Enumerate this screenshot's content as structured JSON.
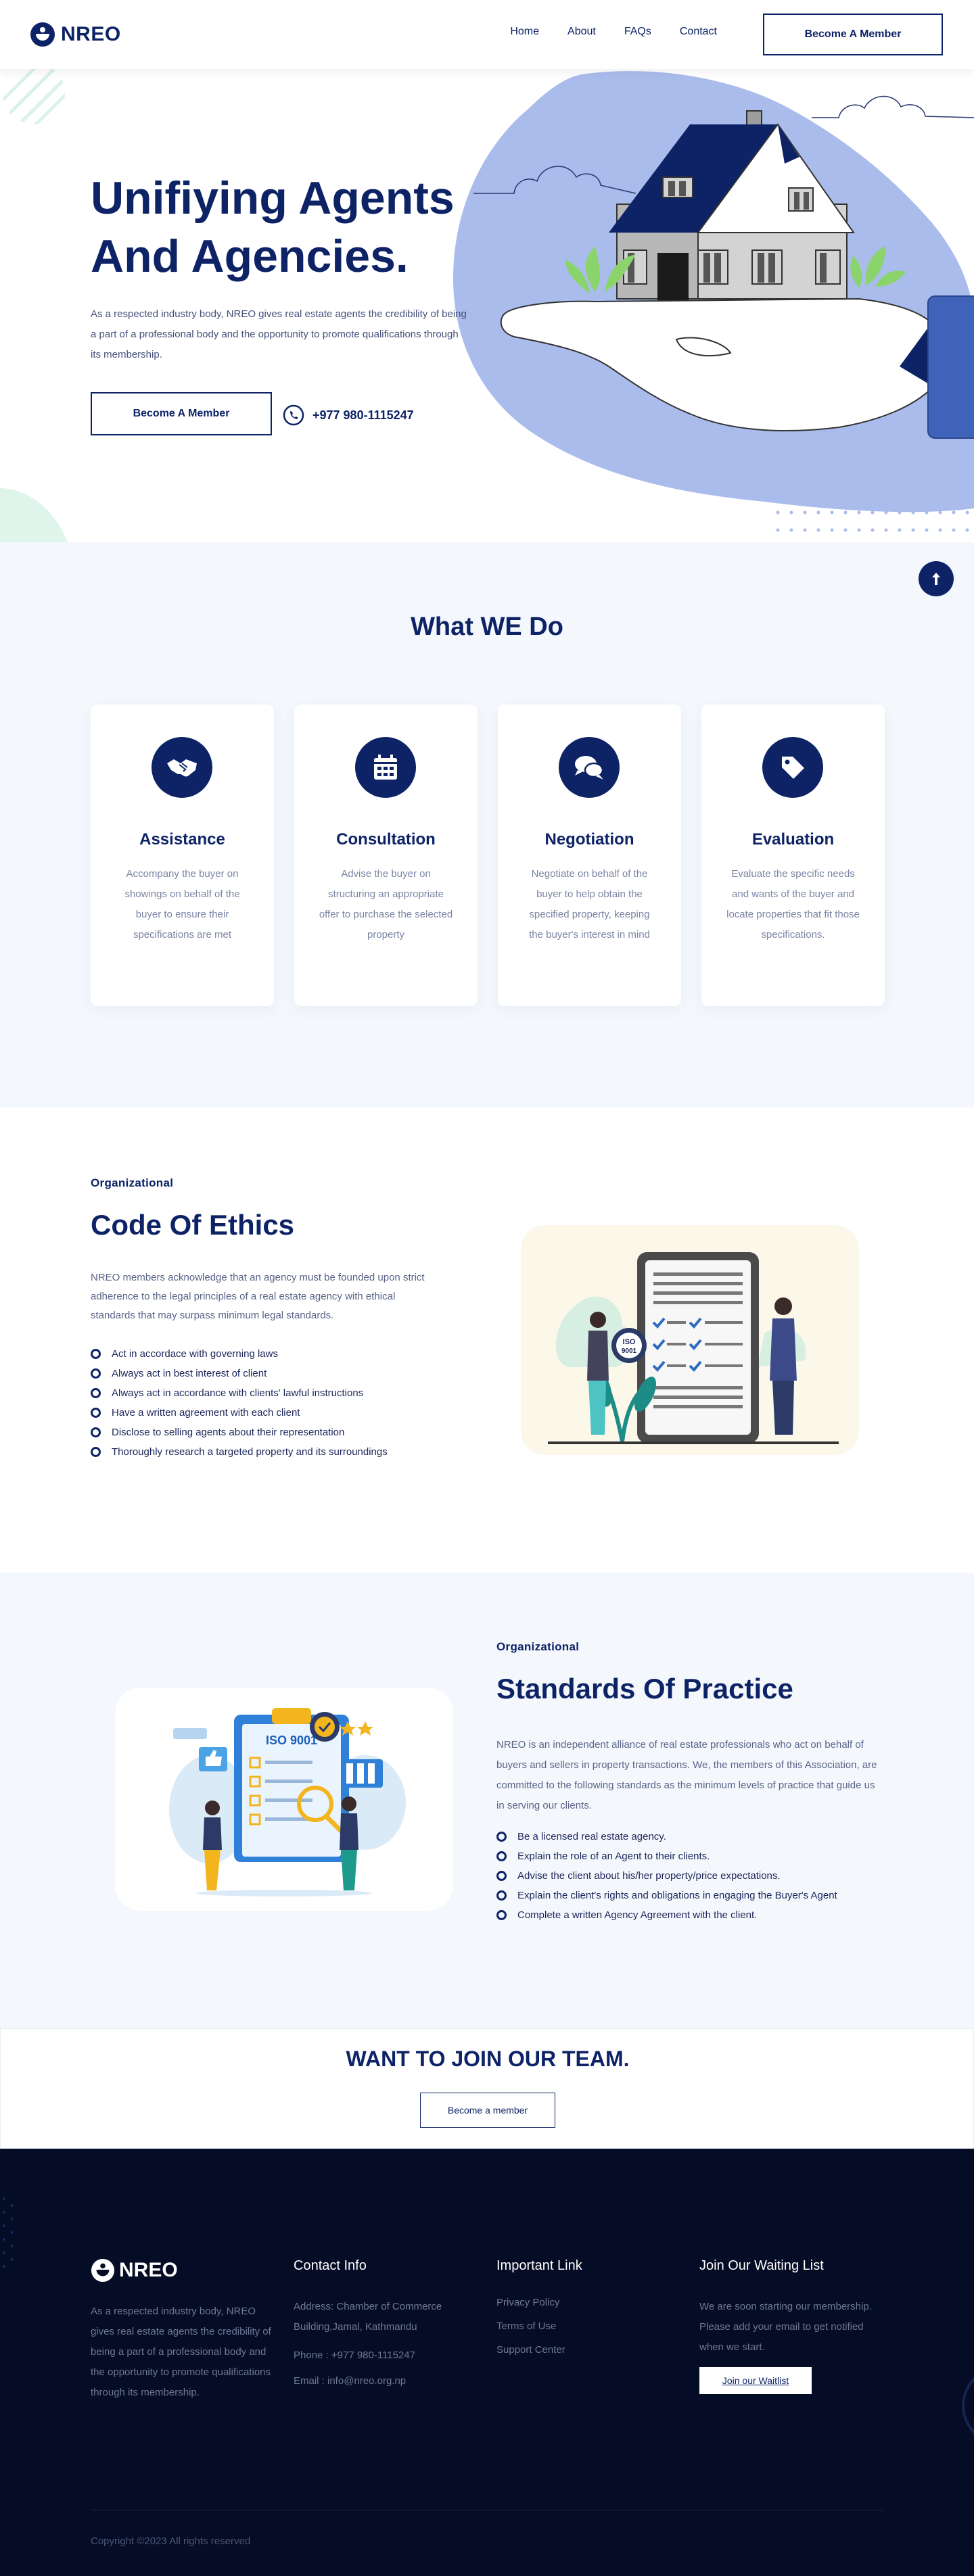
{
  "header": {
    "brand": "NREO",
    "nav": [
      "Home",
      "About",
      "FAQs",
      "Contact"
    ],
    "cta": "Become A Member"
  },
  "hero": {
    "title_line1": "Unifiying Agents",
    "title_line2": "And Agencies.",
    "description": "As a respected industry body, NREO gives real estate agents the credibility of being a part of a professional body and the opportunity to promote qualifications through its membership.",
    "cta": "Become A Member",
    "phone": "+977 980-1115247"
  },
  "services": {
    "title": "What WE Do",
    "cards": [
      {
        "title": "Assistance",
        "text": "Accompany the buyer on showings on behalf of the buyer to ensure their specifications are met",
        "icon": "handshake-icon"
      },
      {
        "title": "Consultation",
        "text": "Advise the buyer on structuring an appropriate offer to purchase the selected property",
        "icon": "calendar-icon"
      },
      {
        "title": "Negotiation",
        "text": "Negotiate on behalf of the buyer to help obtain the specified property, keeping the buyer's interest in mind",
        "icon": "chat-icon"
      },
      {
        "title": "Evaluation",
        "text": "Evaluate the specific needs and wants of the buyer and locate properties that fit those specifications.",
        "icon": "tag-icon"
      }
    ]
  },
  "ethics": {
    "eyebrow": "Organizational",
    "title": "Code Of Ethics",
    "description": "NREO members acknowledge that an agency must be founded upon strict adherence to the legal principles of a real estate agency with ethical standards that may surpass minimum legal standards.",
    "items": [
      "Act in accordace with governing laws",
      "Always act in best interest of client",
      "Always act in accordance with clients' lawful instructions",
      "Have a written agreement with each client",
      "Disclose to selling agents about their representation",
      "Thoroughly research a targeted property and its surroundings"
    ],
    "badge_top": "ISO",
    "badge_bottom": "9001"
  },
  "standards": {
    "eyebrow": "Organizational",
    "title": "Standards Of Practice",
    "description": "NREO is an independent alliance of real estate professionals who act on behalf of buyers and sellers in property transactions. We, the members of this Association, are committed to the following standards as the minimum levels of practice that guide us in serving our clients.",
    "items": [
      "Be a licensed real estate agency.",
      "Explain the role of an Agent to their clients.",
      "Advise the client about his/her property/price expectations.",
      "Explain the client's rights and obligations in engaging the Buyer's Agent",
      "Complete a written Agency Agreement with the client."
    ],
    "clipboard_label": "ISO 9001"
  },
  "join": {
    "title": "WANT TO JOIN OUR TEAM.",
    "cta": "Become a member"
  },
  "footer": {
    "brand": "NREO",
    "about": "As a respected industry body, NREO gives real estate agents the credibility of being a part of a professional body and the opportunity to promote qualifications through its membership.",
    "contact_title": "Contact Info",
    "address": "Address: Chamber of Commerce Building,Jamal, Kathmandu",
    "phone": "Phone : +977 980-1115247",
    "email": "Email : info@nreo.org.np",
    "links_title": "Important Link",
    "links": [
      "Privacy Policy",
      "Terms of Use",
      "Support Center"
    ],
    "waitlist_title": "Join Our Waiting List",
    "waitlist_text": "We are soon starting our membership. Please add your email to get notified when we start.",
    "waitlist_cta": "Join our Waitlist",
    "copyright": "Copyright ©2023 All rights reserved"
  },
  "colors": {
    "primary": "#0d2366",
    "hero_blob": "#a9bceb",
    "section_bg": "#f4f8fd",
    "footer_bg": "#050c25"
  }
}
